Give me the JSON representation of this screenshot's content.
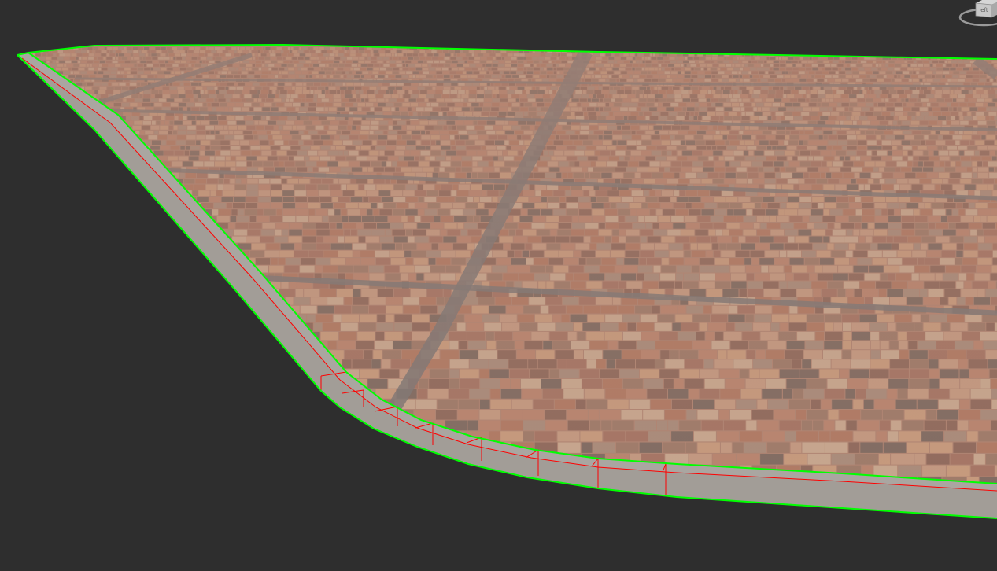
{
  "viewport": {
    "background": "#2e2e2e"
  },
  "viewcube": {
    "face_label": "left",
    "icon": "viewcube-icon",
    "ring_icon": "orbit-ring-icon"
  },
  "selection": {
    "outline_color": "#00ff00",
    "edge_color": "#ff0000"
  },
  "materials": {
    "paving": {
      "icon": "brick-paving-texture",
      "base_color": "#b08573",
      "brick_colors": [
        "#b98570",
        "#c49a82",
        "#a57565",
        "#8f6a5d",
        "#c8a890",
        "#b07a64",
        "#9e7b6a",
        "#c79b7e",
        "#a98c7c",
        "#7f6b62"
      ]
    },
    "joint_strip": {
      "color": "#7c7775"
    },
    "curb": {
      "top_color": "#aaa6a1",
      "side_color": "#a29d97"
    }
  }
}
